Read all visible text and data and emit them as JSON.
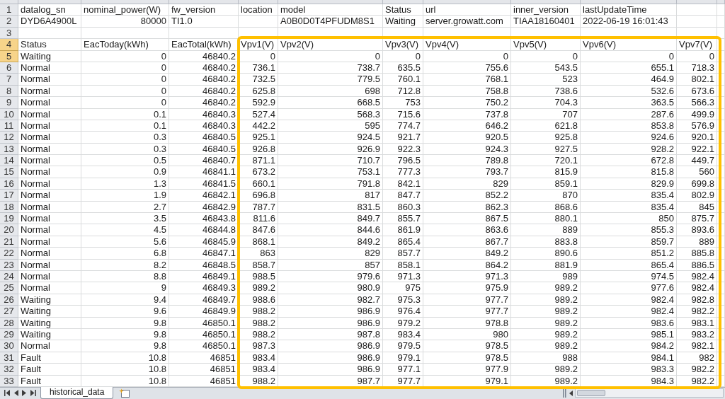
{
  "spreadsheet": {
    "rows": [
      {
        "number": "1",
        "selected": false,
        "kind": "text",
        "cells": [
          "datalog_sn",
          "nominal_power(W)",
          "fw_version",
          "location",
          "model",
          "Status",
          "url",
          "inner_version",
          "lastUpdateTime"
        ]
      },
      {
        "number": "2",
        "selected": false,
        "kind": "mixed",
        "cells": [
          {
            "text": "DYD6A4900L",
            "kind": "text"
          },
          {
            "text": "80000",
            "kind": "number"
          },
          {
            "text": "TI1.0",
            "kind": "text"
          },
          {
            "kind": "empty"
          },
          {
            "text": "A0B0D0T4PFUDM8S1",
            "kind": "text"
          },
          {
            "text": "Waiting",
            "kind": "text"
          },
          {
            "text": "server.growatt.com",
            "kind": "text"
          },
          {
            "text": "TIAA18160401",
            "kind": "text"
          },
          {
            "text": "2022-06-19 16:01:43",
            "kind": "text"
          }
        ]
      },
      {
        "number": "3",
        "selected": false,
        "kind": "blank"
      },
      {
        "number": "4",
        "selected": true,
        "kind": "text",
        "cells": [
          "Status",
          "EacToday(kWh)",
          "EacTotal(kWh)",
          "Vpv1(V)",
          "Vpv2(V)",
          "Vpv3(V)",
          "Vpv4(V)",
          "Vpv5(V)",
          "Vpv6(V)",
          "Vpv7(V)"
        ]
      },
      {
        "number": "5",
        "selected": true,
        "kind": "record",
        "cells": [
          "Waiting",
          "0",
          "46840.2",
          "0",
          "0",
          "0",
          "0",
          "0",
          "0",
          "0"
        ]
      },
      {
        "number": "6",
        "selected": false,
        "kind": "record",
        "cells": [
          "Normal",
          "0",
          "46840.2",
          "736.1",
          "738.7",
          "635.5",
          "755.6",
          "543.5",
          "655.1",
          "718.3"
        ]
      },
      {
        "number": "7",
        "selected": false,
        "kind": "record",
        "cells": [
          "Normal",
          "0",
          "46840.2",
          "732.5",
          "779.5",
          "760.1",
          "768.1",
          "523",
          "464.9",
          "802.1"
        ]
      },
      {
        "number": "8",
        "selected": false,
        "kind": "record",
        "cells": [
          "Normal",
          "0",
          "46840.2",
          "625.8",
          "698",
          "712.8",
          "758.8",
          "738.6",
          "532.6",
          "673.6"
        ]
      },
      {
        "number": "9",
        "selected": false,
        "kind": "record",
        "cells": [
          "Normal",
          "0",
          "46840.2",
          "592.9",
          "668.5",
          "753",
          "750.2",
          "704.3",
          "363.5",
          "566.3"
        ]
      },
      {
        "number": "10",
        "selected": false,
        "kind": "record",
        "cells": [
          "Normal",
          "0.1",
          "46840.3",
          "527.4",
          "568.3",
          "715.6",
          "737.8",
          "707",
          "287.6",
          "499.9"
        ]
      },
      {
        "number": "11",
        "selected": false,
        "kind": "record",
        "cells": [
          "Normal",
          "0.1",
          "46840.3",
          "442.2",
          "595",
          "774.7",
          "646.2",
          "621.8",
          "853.8",
          "576.9"
        ]
      },
      {
        "number": "12",
        "selected": false,
        "kind": "record",
        "cells": [
          "Normal",
          "0.3",
          "46840.5",
          "925.1",
          "924.5",
          "921.7",
          "920.5",
          "925.8",
          "924.6",
          "920.1"
        ]
      },
      {
        "number": "13",
        "selected": false,
        "kind": "record",
        "cells": [
          "Normal",
          "0.3",
          "46840.5",
          "926.8",
          "926.9",
          "922.3",
          "924.3",
          "927.5",
          "928.2",
          "922.1"
        ]
      },
      {
        "number": "14",
        "selected": false,
        "kind": "record",
        "cells": [
          "Normal",
          "0.5",
          "46840.7",
          "871.1",
          "710.7",
          "796.5",
          "789.8",
          "720.1",
          "672.8",
          "449.7"
        ]
      },
      {
        "number": "15",
        "selected": false,
        "kind": "record",
        "cells": [
          "Normal",
          "0.9",
          "46841.1",
          "673.2",
          "753.1",
          "777.3",
          "793.7",
          "815.9",
          "815.8",
          "560"
        ]
      },
      {
        "number": "16",
        "selected": false,
        "kind": "record",
        "cells": [
          "Normal",
          "1.3",
          "46841.5",
          "660.1",
          "791.8",
          "842.1",
          "829",
          "859.1",
          "829.9",
          "699.8"
        ]
      },
      {
        "number": "17",
        "selected": false,
        "kind": "record",
        "cells": [
          "Normal",
          "1.9",
          "46842.1",
          "696.8",
          "817",
          "847.7",
          "852.2",
          "870",
          "835.4",
          "802.9"
        ]
      },
      {
        "number": "18",
        "selected": false,
        "kind": "record",
        "cells": [
          "Normal",
          "2.7",
          "46842.9",
          "787.7",
          "831.5",
          "860.3",
          "862.3",
          "868.6",
          "835.4",
          "845"
        ]
      },
      {
        "number": "19",
        "selected": false,
        "kind": "record",
        "cells": [
          "Normal",
          "3.5",
          "46843.8",
          "811.6",
          "849.7",
          "855.7",
          "867.5",
          "880.1",
          "850",
          "875.7"
        ]
      },
      {
        "number": "20",
        "selected": false,
        "kind": "record",
        "cells": [
          "Normal",
          "4.5",
          "46844.8",
          "847.6",
          "844.6",
          "861.9",
          "863.6",
          "889",
          "855.3",
          "893.6"
        ]
      },
      {
        "number": "21",
        "selected": false,
        "kind": "record",
        "cells": [
          "Normal",
          "5.6",
          "46845.9",
          "868.1",
          "849.2",
          "865.4",
          "867.7",
          "883.8",
          "859.7",
          "889"
        ]
      },
      {
        "number": "22",
        "selected": false,
        "kind": "record",
        "cells": [
          "Normal",
          "6.8",
          "46847.1",
          "863",
          "829",
          "857.7",
          "849.2",
          "890.6",
          "851.2",
          "885.8"
        ]
      },
      {
        "number": "23",
        "selected": false,
        "kind": "record",
        "cells": [
          "Normal",
          "8.2",
          "46848.5",
          "858.7",
          "857",
          "858.1",
          "864.2",
          "881.9",
          "865.4",
          "886.5"
        ]
      },
      {
        "number": "24",
        "selected": false,
        "kind": "record",
        "cells": [
          "Normal",
          "8.8",
          "46849.1",
          "988.5",
          "979.6",
          "971.3",
          "971.3",
          "989",
          "974.5",
          "982.4"
        ]
      },
      {
        "number": "25",
        "selected": false,
        "kind": "record",
        "cells": [
          "Normal",
          "9",
          "46849.3",
          "989.2",
          "980.9",
          "975",
          "975.9",
          "989.2",
          "977.6",
          "982.4"
        ]
      },
      {
        "number": "26",
        "selected": false,
        "kind": "record",
        "cells": [
          "Waiting",
          "9.4",
          "46849.7",
          "988.6",
          "982.7",
          "975.3",
          "977.7",
          "989.2",
          "982.4",
          "982.8"
        ]
      },
      {
        "number": "27",
        "selected": false,
        "kind": "record",
        "cells": [
          "Waiting",
          "9.6",
          "46849.9",
          "988.2",
          "986.9",
          "976.4",
          "977.7",
          "989.2",
          "982.4",
          "982.2"
        ]
      },
      {
        "number": "28",
        "selected": false,
        "kind": "record",
        "cells": [
          "Waiting",
          "9.8",
          "46850.1",
          "988.2",
          "986.9",
          "979.2",
          "978.8",
          "989.2",
          "983.6",
          "983.1"
        ]
      },
      {
        "number": "29",
        "selected": false,
        "kind": "record",
        "cells": [
          "Waiting",
          "9.8",
          "46850.1",
          "988.2",
          "987.8",
          "983.4",
          "980",
          "989.2",
          "985.1",
          "983.2"
        ]
      },
      {
        "number": "30",
        "selected": false,
        "kind": "record",
        "cells": [
          "Normal",
          "9.8",
          "46850.1",
          "987.3",
          "986.9",
          "979.5",
          "978.5",
          "989.2",
          "984.2",
          "982.1"
        ]
      },
      {
        "number": "31",
        "selected": false,
        "kind": "record",
        "cells": [
          "Fault",
          "10.8",
          "46851",
          "983.4",
          "986.9",
          "979.1",
          "978.5",
          "988",
          "984.1",
          "982"
        ]
      },
      {
        "number": "32",
        "selected": false,
        "kind": "record",
        "cells": [
          "Fault",
          "10.8",
          "46851",
          "983.4",
          "986.9",
          "977.1",
          "977.9",
          "989.2",
          "983.3",
          "982.2"
        ]
      },
      {
        "number": "33",
        "selected": false,
        "kind": "record",
        "cells": [
          "Fault",
          "10.8",
          "46851",
          "988.2",
          "987.7",
          "977.7",
          "979.1",
          "989.2",
          "984.3",
          "982.2"
        ]
      }
    ]
  },
  "sheet_tabs": [
    {
      "label": "historical_data",
      "selected": true
    }
  ]
}
